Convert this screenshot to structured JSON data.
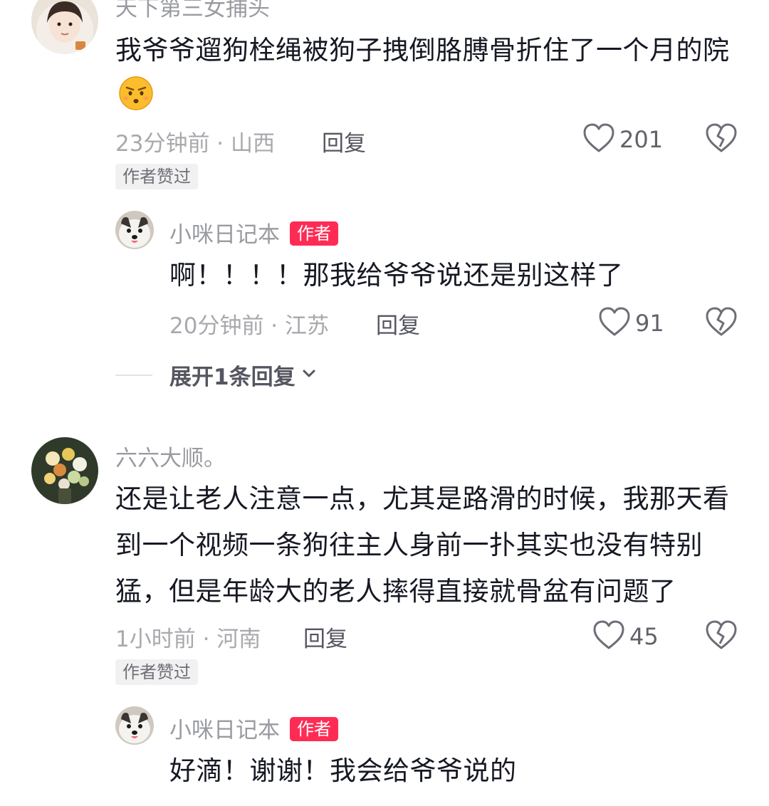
{
  "comments": [
    {
      "username": "天下第三女捕头",
      "text": "我爷爷遛狗栓绳被狗子拽倒胳膊骨折住了一个月的院",
      "emoji": "worried-face",
      "time_location": "23分钟前 · 山西",
      "reply_label": "回复",
      "likes": "201",
      "liked_by_author": "作者赞过",
      "replies": [
        {
          "username": "小咪日记本",
          "author_tag": "作者",
          "text": "啊！！！！那我给爷爷说还是别这样了",
          "time_location": "20分钟前 · 江苏",
          "reply_label": "回复",
          "likes": "91"
        }
      ],
      "expand_label": "展开1条回复"
    },
    {
      "username": "六六大顺。",
      "text": "还是让老人注意一点，尤其是路滑的时候，我那天看到一个视频一条狗往主人身前一扑其实也没有特别猛，但是年龄大的老人摔得直接就骨盆有问题了",
      "time_location": "1小时前 · 河南",
      "reply_label": "回复",
      "likes": "45",
      "liked_by_author": "作者赞过",
      "replies": [
        {
          "username": "小咪日记本",
          "author_tag": "作者",
          "text": "好滴！谢谢！我会给爷爷说的"
        }
      ]
    }
  ],
  "icons": {
    "like": "heart-outline-icon",
    "dislike": "broken-heart-icon",
    "expand": "chevron-down-icon"
  },
  "colors": {
    "author_tag": "#fe2c55",
    "text": "#161823",
    "meta": "#a8a9ad"
  }
}
